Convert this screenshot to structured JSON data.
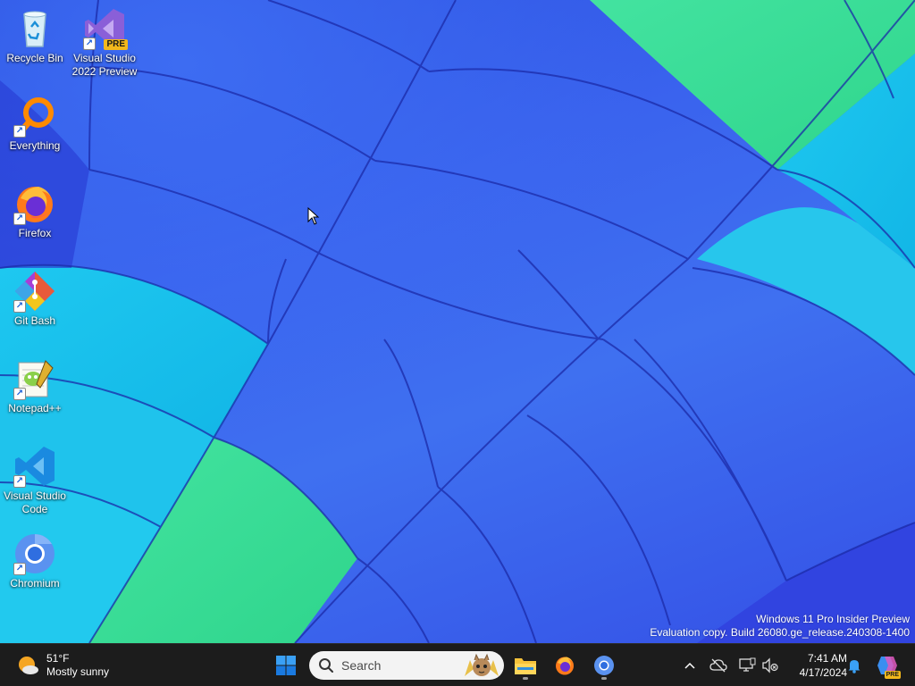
{
  "desktop": {
    "icons": [
      {
        "label": "Recycle Bin",
        "icon": "recycle-bin-icon"
      },
      {
        "label": "Visual Studio 2022 Preview",
        "icon": "visual-studio-preview-icon",
        "badge": "PRE"
      },
      {
        "label": "Everything",
        "icon": "everything-search-icon"
      },
      {
        "label": "Firefox",
        "icon": "firefox-icon"
      },
      {
        "label": "Git Bash",
        "icon": "git-bash-icon"
      },
      {
        "label": "Notepad++",
        "icon": "notepad-plus-plus-icon"
      },
      {
        "label": "Visual Studio Code",
        "icon": "vscode-icon"
      },
      {
        "label": "Chromium",
        "icon": "chromium-icon"
      }
    ],
    "shortcut_arrow": "↗"
  },
  "watermark": {
    "line1": "Windows 11 Pro Insider Preview",
    "line2": "Evaluation copy. Build 26080.ge_release.240308-1400"
  },
  "taskbar": {
    "weather": {
      "temp": "51°F",
      "condition": "Mostly sunny"
    },
    "search": {
      "placeholder": "Search"
    },
    "pinned": [
      "start-button",
      "file-explorer",
      "firefox",
      "chromium"
    ],
    "tray": {
      "time": "7:41 AM",
      "date": "4/17/2024",
      "copilot_badge": "PRE"
    }
  },
  "colors": {
    "taskbar_bg": "#1c1c1c",
    "wallpaper_blue": "#3a63ee",
    "wallpaper_cyan": "#22d3ee",
    "wallpaper_green": "#4ade80",
    "windows_blue": "#0078d4"
  }
}
